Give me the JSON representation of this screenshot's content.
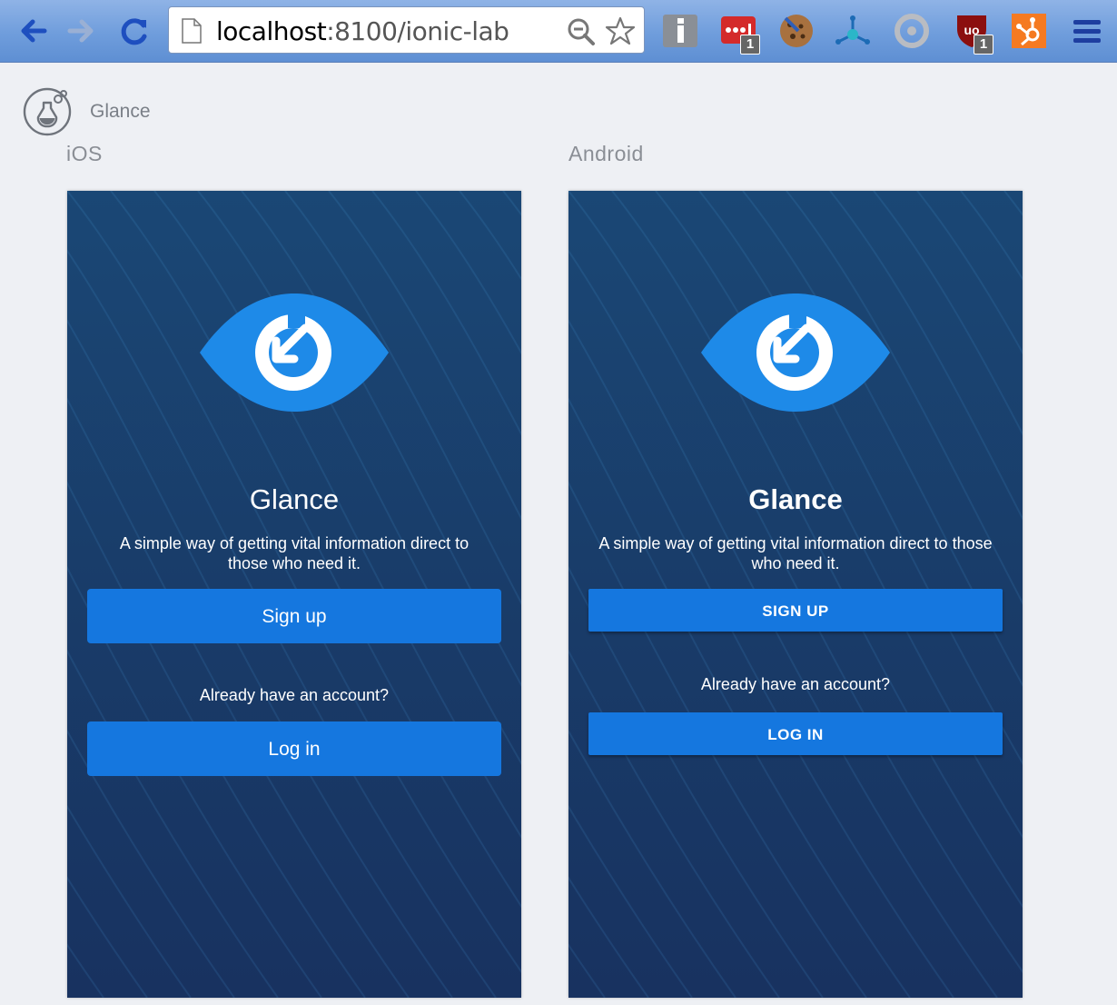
{
  "browser": {
    "url_host": "localhost",
    "url_rest": ":8100/ionic-lab",
    "extensions": [
      {
        "name": "info-icon",
        "badge": ""
      },
      {
        "name": "lastpass-icon",
        "badge": "1"
      },
      {
        "name": "cookie-icon",
        "badge": ""
      },
      {
        "name": "network-icon",
        "badge": ""
      },
      {
        "name": "circle-a-icon",
        "badge": ""
      },
      {
        "name": "ublock-icon",
        "badge": "1"
      },
      {
        "name": "hubspot-icon",
        "badge": ""
      }
    ]
  },
  "lab": {
    "title": "Glance",
    "platforms": {
      "ios": "iOS",
      "android": "Android"
    }
  },
  "ios": {
    "app_name": "Glance",
    "tagline": "A simple way of getting vital information direct to those who need it.",
    "signup_label": "Sign up",
    "account_prompt": "Already have an account?",
    "login_label": "Log in"
  },
  "android": {
    "app_name": "Glance",
    "tagline": "A simple way of getting vital information direct to those who need it.",
    "signup_label": "SIGN UP",
    "account_prompt": "Already have an account?",
    "login_label": "LOG IN"
  },
  "colors": {
    "accent": "#1577df",
    "phone_background": "#193c69",
    "eye": "#1e8ae8"
  }
}
